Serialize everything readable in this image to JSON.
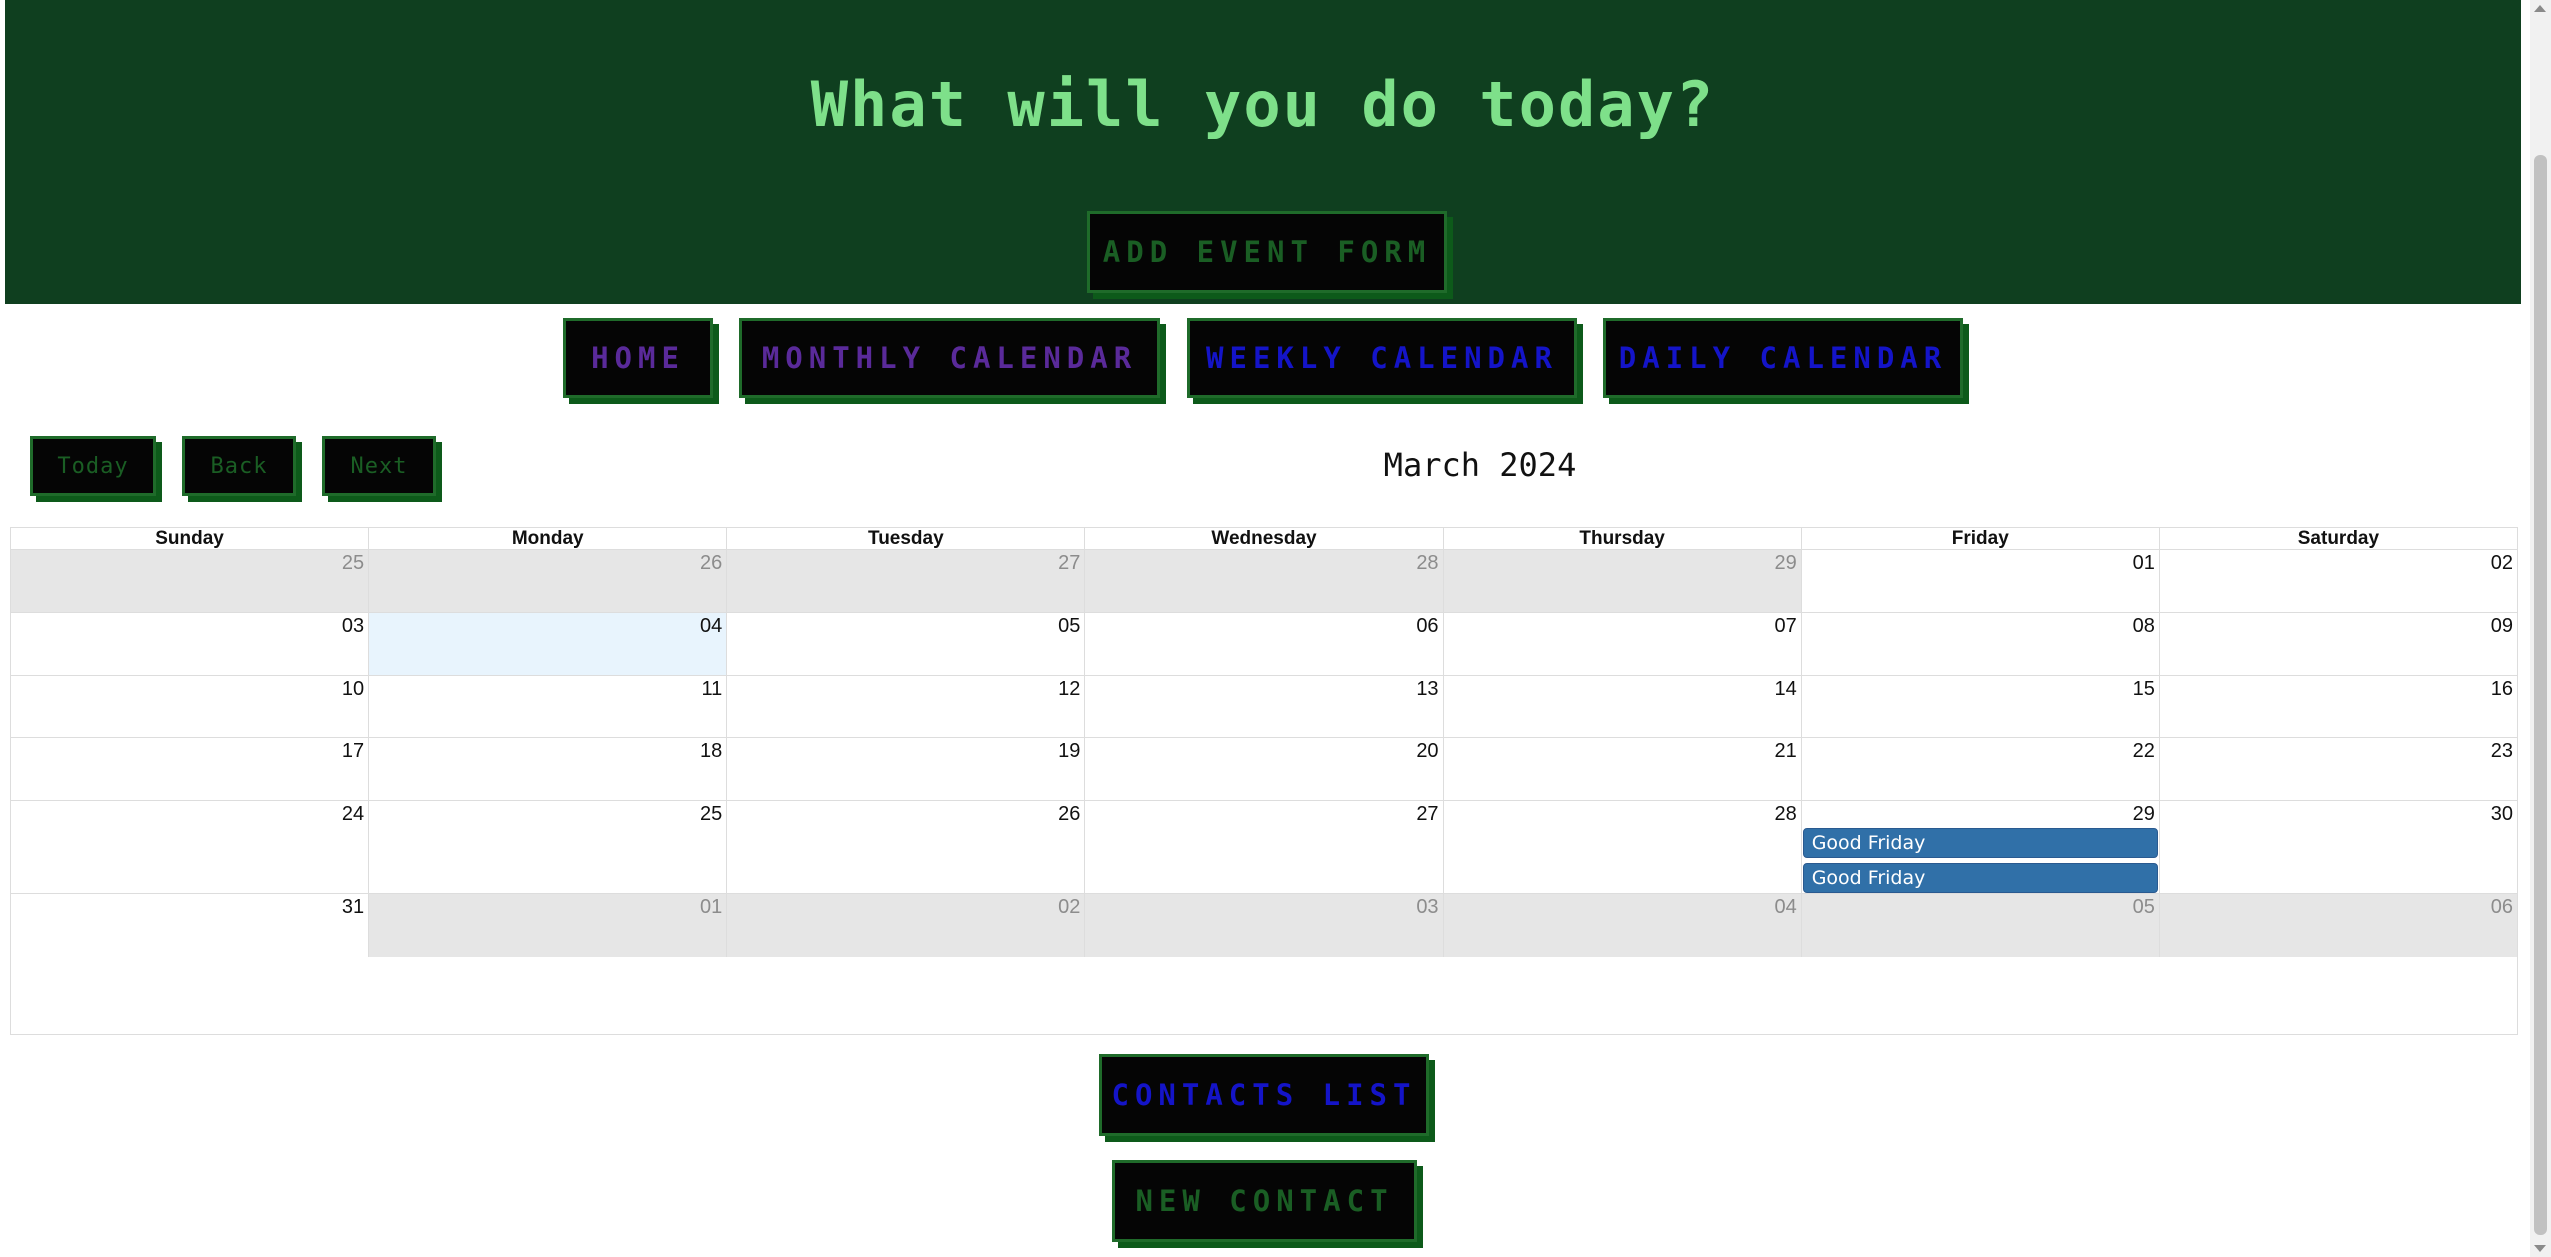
{
  "header": {
    "title": "What will you do today?",
    "add_event_label": "ADD EVENT FORM"
  },
  "nav": {
    "home": "HOME",
    "monthly": "MONTHLY CALENDAR",
    "weekly": "WEEKLY CALENDAR",
    "daily": "DAILY CALENDAR"
  },
  "toolbar": {
    "today": "Today",
    "back": "Back",
    "next": "Next",
    "month_title": "March 2024"
  },
  "calendar": {
    "weekdays": [
      "Sunday",
      "Monday",
      "Tuesday",
      "Wednesday",
      "Thursday",
      "Friday",
      "Saturday"
    ],
    "weeks": [
      [
        "25",
        "26",
        "27",
        "28",
        "29",
        "01",
        "02"
      ],
      [
        "03",
        "04",
        "05",
        "06",
        "07",
        "08",
        "09"
      ],
      [
        "10",
        "11",
        "12",
        "13",
        "14",
        "15",
        "16"
      ],
      [
        "17",
        "18",
        "19",
        "20",
        "21",
        "22",
        "23"
      ],
      [
        "24",
        "25",
        "26",
        "27",
        "28",
        "29",
        "30"
      ],
      [
        "31",
        "01",
        "02",
        "03",
        "04",
        "05",
        "06"
      ]
    ],
    "events": [
      "Good Friday",
      "Good Friday"
    ]
  },
  "footer": {
    "contacts": "CONTACTS LIST",
    "new_contact": "NEW CONTACT"
  },
  "colors": {
    "header_bg": "#0f3f1f",
    "title_green": "#7ee08a",
    "event_blue": "#3070a8"
  }
}
